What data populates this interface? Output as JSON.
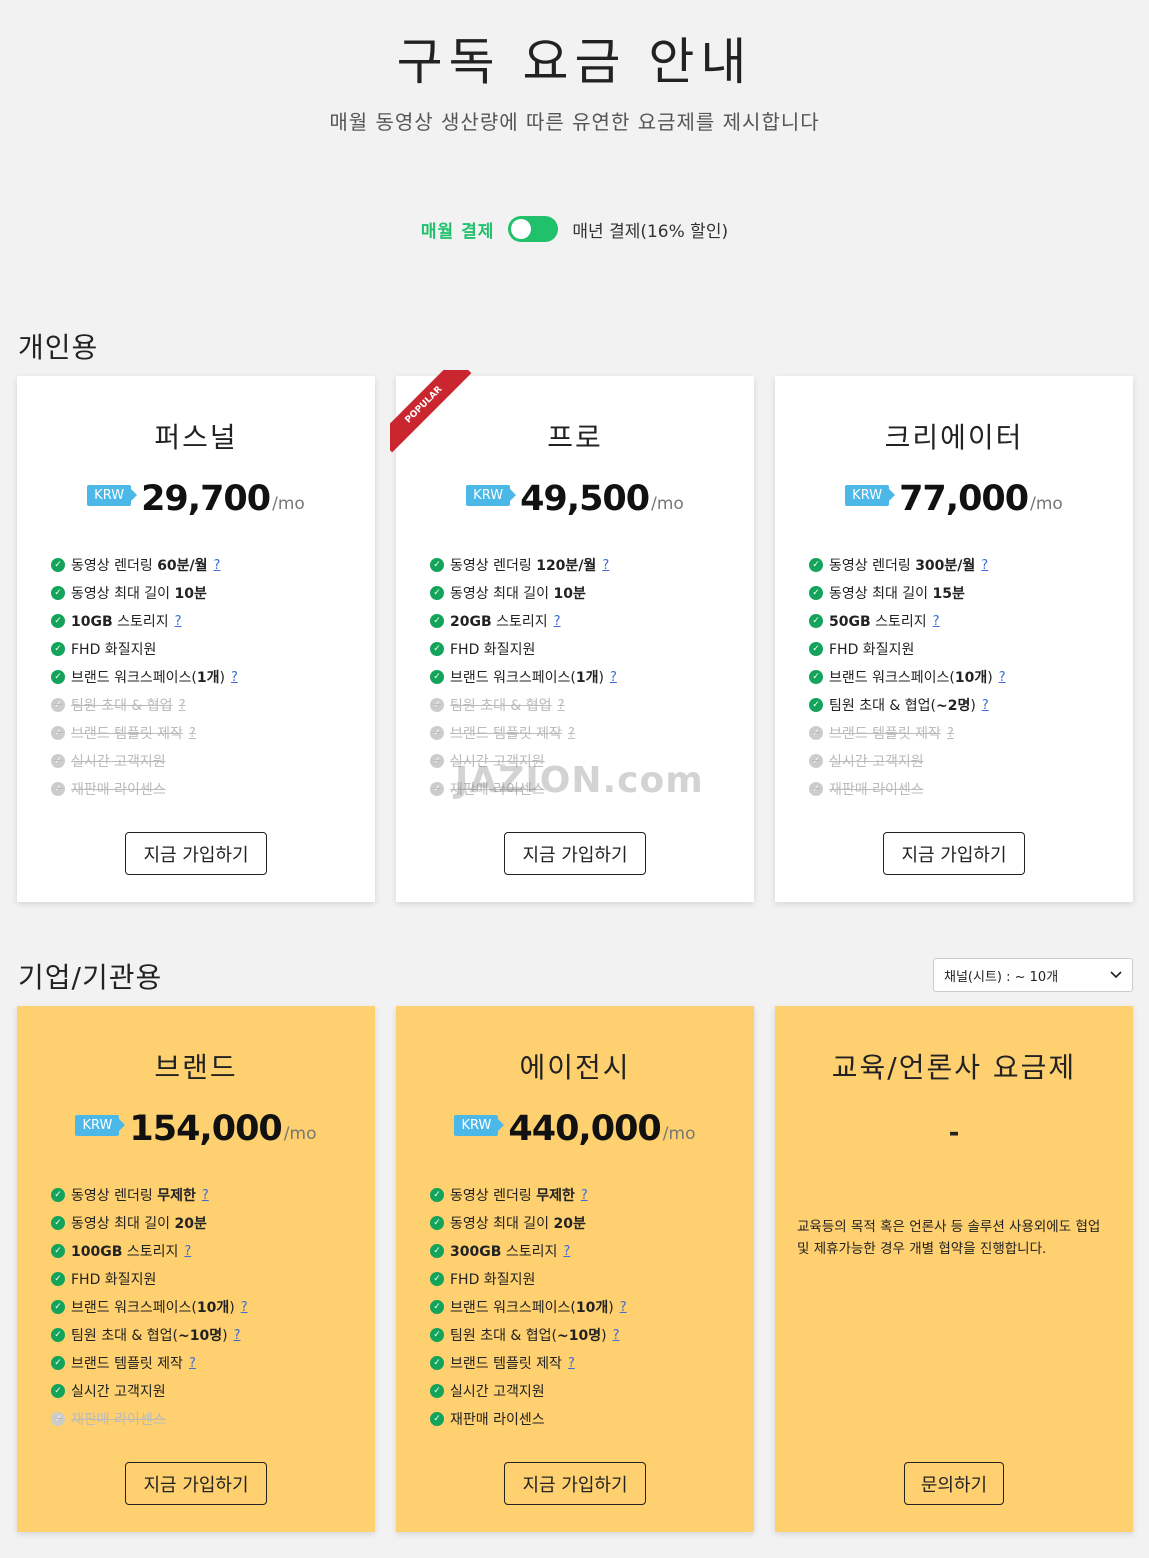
{
  "header": {
    "title": "구독 요금 안내",
    "subtitle": "매월 동영상 생산량에 따른 유연한 요금제를 제시합니다"
  },
  "billing": {
    "monthly_label": "매월 결제",
    "yearly_label": "매년 결제(16% 할인)"
  },
  "sections": {
    "personal_title": "개인용",
    "business_title": "기업/기관용",
    "channel_select": "채널(시트) : ~ 10개"
  },
  "personal": [
    {
      "name": "퍼스널",
      "currency": "KRW",
      "amount": "29,700",
      "per": "/mo",
      "features": [
        {
          "text": "동영상 렌더링 60분/월",
          "on": true,
          "q": true
        },
        {
          "text": "동영상 최대 길이 10분",
          "on": true,
          "q": false
        },
        {
          "text": "10GB 스토리지",
          "on": true,
          "q": true
        },
        {
          "text": "FHD 화질지원",
          "on": true,
          "q": false
        },
        {
          "text": "브랜드 워크스페이스(1개)",
          "on": true,
          "q": true
        },
        {
          "text": "팀원 초대 & 협업",
          "on": false,
          "q": true
        },
        {
          "text": "브랜드 템플릿 제작",
          "on": false,
          "q": true
        },
        {
          "text": "실시간 고객지원",
          "on": false,
          "q": false
        },
        {
          "text": "재판매 라이센스",
          "on": false,
          "q": false
        }
      ],
      "cta": "지금 가입하기"
    },
    {
      "name": "프로",
      "ribbon": "POPULAR",
      "currency": "KRW",
      "amount": "49,500",
      "per": "/mo",
      "features": [
        {
          "text": "동영상 렌더링 120분/월",
          "on": true,
          "q": true
        },
        {
          "text": "동영상 최대 길이 10분",
          "on": true,
          "q": false
        },
        {
          "text": "20GB 스토리지",
          "on": true,
          "q": true
        },
        {
          "text": "FHD 화질지원",
          "on": true,
          "q": false
        },
        {
          "text": "브랜드 워크스페이스(1개)",
          "on": true,
          "q": true
        },
        {
          "text": "팀원 초대 & 협업",
          "on": false,
          "q": true
        },
        {
          "text": "브랜드 템플릿 제작",
          "on": false,
          "q": true
        },
        {
          "text": "실시간 고객지원",
          "on": false,
          "q": false
        },
        {
          "text": "재판매 라이센스",
          "on": false,
          "q": false
        }
      ],
      "cta": "지금 가입하기"
    },
    {
      "name": "크리에이터",
      "currency": "KRW",
      "amount": "77,000",
      "per": "/mo",
      "features": [
        {
          "text": "동영상 렌더링 300분/월",
          "on": true,
          "q": true
        },
        {
          "text": "동영상 최대 길이 15분",
          "on": true,
          "q": false
        },
        {
          "text": "50GB 스토리지",
          "on": true,
          "q": true
        },
        {
          "text": "FHD 화질지원",
          "on": true,
          "q": false
        },
        {
          "text": "브랜드 워크스페이스(10개)",
          "on": true,
          "q": true
        },
        {
          "text": "팀원 초대 & 협업(~2명)",
          "on": true,
          "q": true
        },
        {
          "text": "브랜드 템플릿 제작",
          "on": false,
          "q": true
        },
        {
          "text": "실시간 고객지원",
          "on": false,
          "q": false
        },
        {
          "text": "재판매 라이센스",
          "on": false,
          "q": false
        }
      ],
      "cta": "지금 가입하기"
    }
  ],
  "business": [
    {
      "name": "브랜드",
      "currency": "KRW",
      "amount": "154,000",
      "per": "/mo",
      "features": [
        {
          "text": "동영상 렌더링 무제한",
          "on": true,
          "q": true
        },
        {
          "text": "동영상 최대 길이 20분",
          "on": true,
          "q": false
        },
        {
          "text": "100GB 스토리지",
          "on": true,
          "q": true
        },
        {
          "text": "FHD 화질지원",
          "on": true,
          "q": false
        },
        {
          "text": "브랜드 워크스페이스(10개)",
          "on": true,
          "q": true
        },
        {
          "text": "팀원 초대 & 협업(~10명)",
          "on": true,
          "q": true
        },
        {
          "text": "브랜드 템플릿 제작",
          "on": true,
          "q": true
        },
        {
          "text": "실시간 고객지원",
          "on": true,
          "q": false
        },
        {
          "text": "재판매 라이센스",
          "on": false,
          "q": false
        }
      ],
      "cta": "지금 가입하기"
    },
    {
      "name": "에이전시",
      "currency": "KRW",
      "amount": "440,000",
      "per": "/mo",
      "features": [
        {
          "text": "동영상 렌더링 무제한",
          "on": true,
          "q": true
        },
        {
          "text": "동영상 최대 길이 20분",
          "on": true,
          "q": false
        },
        {
          "text": "300GB 스토리지",
          "on": true,
          "q": true
        },
        {
          "text": "FHD 화질지원",
          "on": true,
          "q": false
        },
        {
          "text": "브랜드 워크스페이스(10개)",
          "on": true,
          "q": true
        },
        {
          "text": "팀원 초대 & 협업(~10명)",
          "on": true,
          "q": true
        },
        {
          "text": "브랜드 템플릿 제작",
          "on": true,
          "q": true
        },
        {
          "text": "실시간 고객지원",
          "on": true,
          "q": false
        },
        {
          "text": "재판매 라이센스",
          "on": true,
          "q": false
        }
      ],
      "cta": "지금 가입하기"
    },
    {
      "name": "교육/언론사 요금제",
      "price_text": "-",
      "description": "교육등의 목적 혹은 언론사 등 솔루션 사용외에도 협업 및 제휴가능한 경우 개별 협약을 진행합니다.",
      "cta": "문의하기"
    }
  ],
  "watermark": "JAZION.com",
  "colors": {
    "accent_green": "#21c06b",
    "check_green": "#13a35a",
    "krw_blue": "#4bb8e8",
    "business_card": "#fed06f",
    "ribbon_red": "#c9262f"
  }
}
